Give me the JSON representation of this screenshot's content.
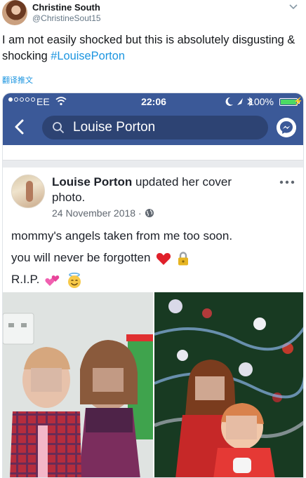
{
  "tweet": {
    "author_name": "Christine South",
    "author_handle": "@ChristineSout15",
    "text_before": "I am not easily shocked but this is absolutely disgusting & shocking ",
    "hashtag": "#LouisePorton",
    "translate_label": "翻译推文"
  },
  "phone_status": {
    "carrier": "EE",
    "time": "22:06",
    "battery": "100%",
    "battery_level": 1.0
  },
  "fb_header": {
    "search_value": "Louise Porton"
  },
  "post": {
    "author": "Louise Porton",
    "action": " updated her cover photo.",
    "date": "24 November 2018 ·",
    "lines": [
      "mommy's angels taken from me too soon.",
      "you will never be forgotten",
      "R.I.P."
    ]
  },
  "colors": {
    "twitter_blue": "#1b95e0",
    "facebook_blue": "#3b5998"
  },
  "icons": [
    "caret-down-icon",
    "wifi-icon",
    "back-chevron-icon",
    "search-icon",
    "messenger-icon",
    "globe-icon",
    "more-icon",
    "heart-emoji",
    "lock-emoji",
    "hearts-emoji",
    "angel-emoji"
  ]
}
